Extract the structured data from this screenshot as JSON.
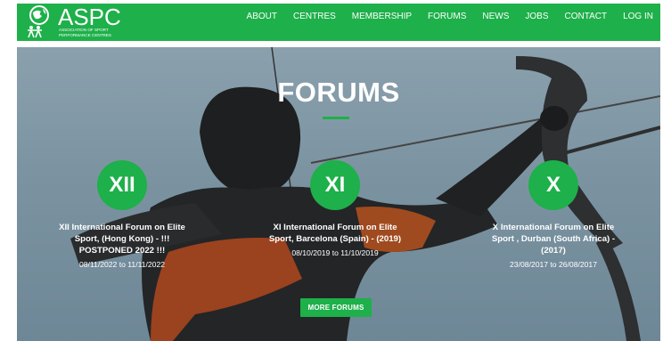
{
  "brand": {
    "name": "ASPC",
    "tagline_line1": "ASSOCIATION OF SPORT",
    "tagline_line2": "PERFORMANCE CENTRES",
    "color": "#1eb04a"
  },
  "nav": {
    "items": [
      {
        "label": "ABOUT"
      },
      {
        "label": "CENTRES"
      },
      {
        "label": "MEMBERSHIP"
      },
      {
        "label": "FORUMS"
      },
      {
        "label": "NEWS"
      },
      {
        "label": "JOBS"
      },
      {
        "label": "CONTACT"
      },
      {
        "label": "LOG IN"
      }
    ]
  },
  "hero": {
    "title": "FORUMS",
    "forums": [
      {
        "badge": "XII",
        "title": "XII International Forum on Elite Sport, (Hong Kong) - !!! POSTPONED 2022 !!!",
        "dates": "08/11/2022 to 11/11/2022"
      },
      {
        "badge": "XI",
        "title": "XI International Forum on Elite Sport, Barcelona (Spain) - (2019)",
        "dates": "08/10/2019 to 11/10/2019"
      },
      {
        "badge": "X",
        "title": "X International Forum on Elite Sport , Durban (South Africa) - (2017)",
        "dates": "23/08/2017 to 26/08/2017"
      }
    ],
    "more_label": "MORE FORUMS"
  }
}
